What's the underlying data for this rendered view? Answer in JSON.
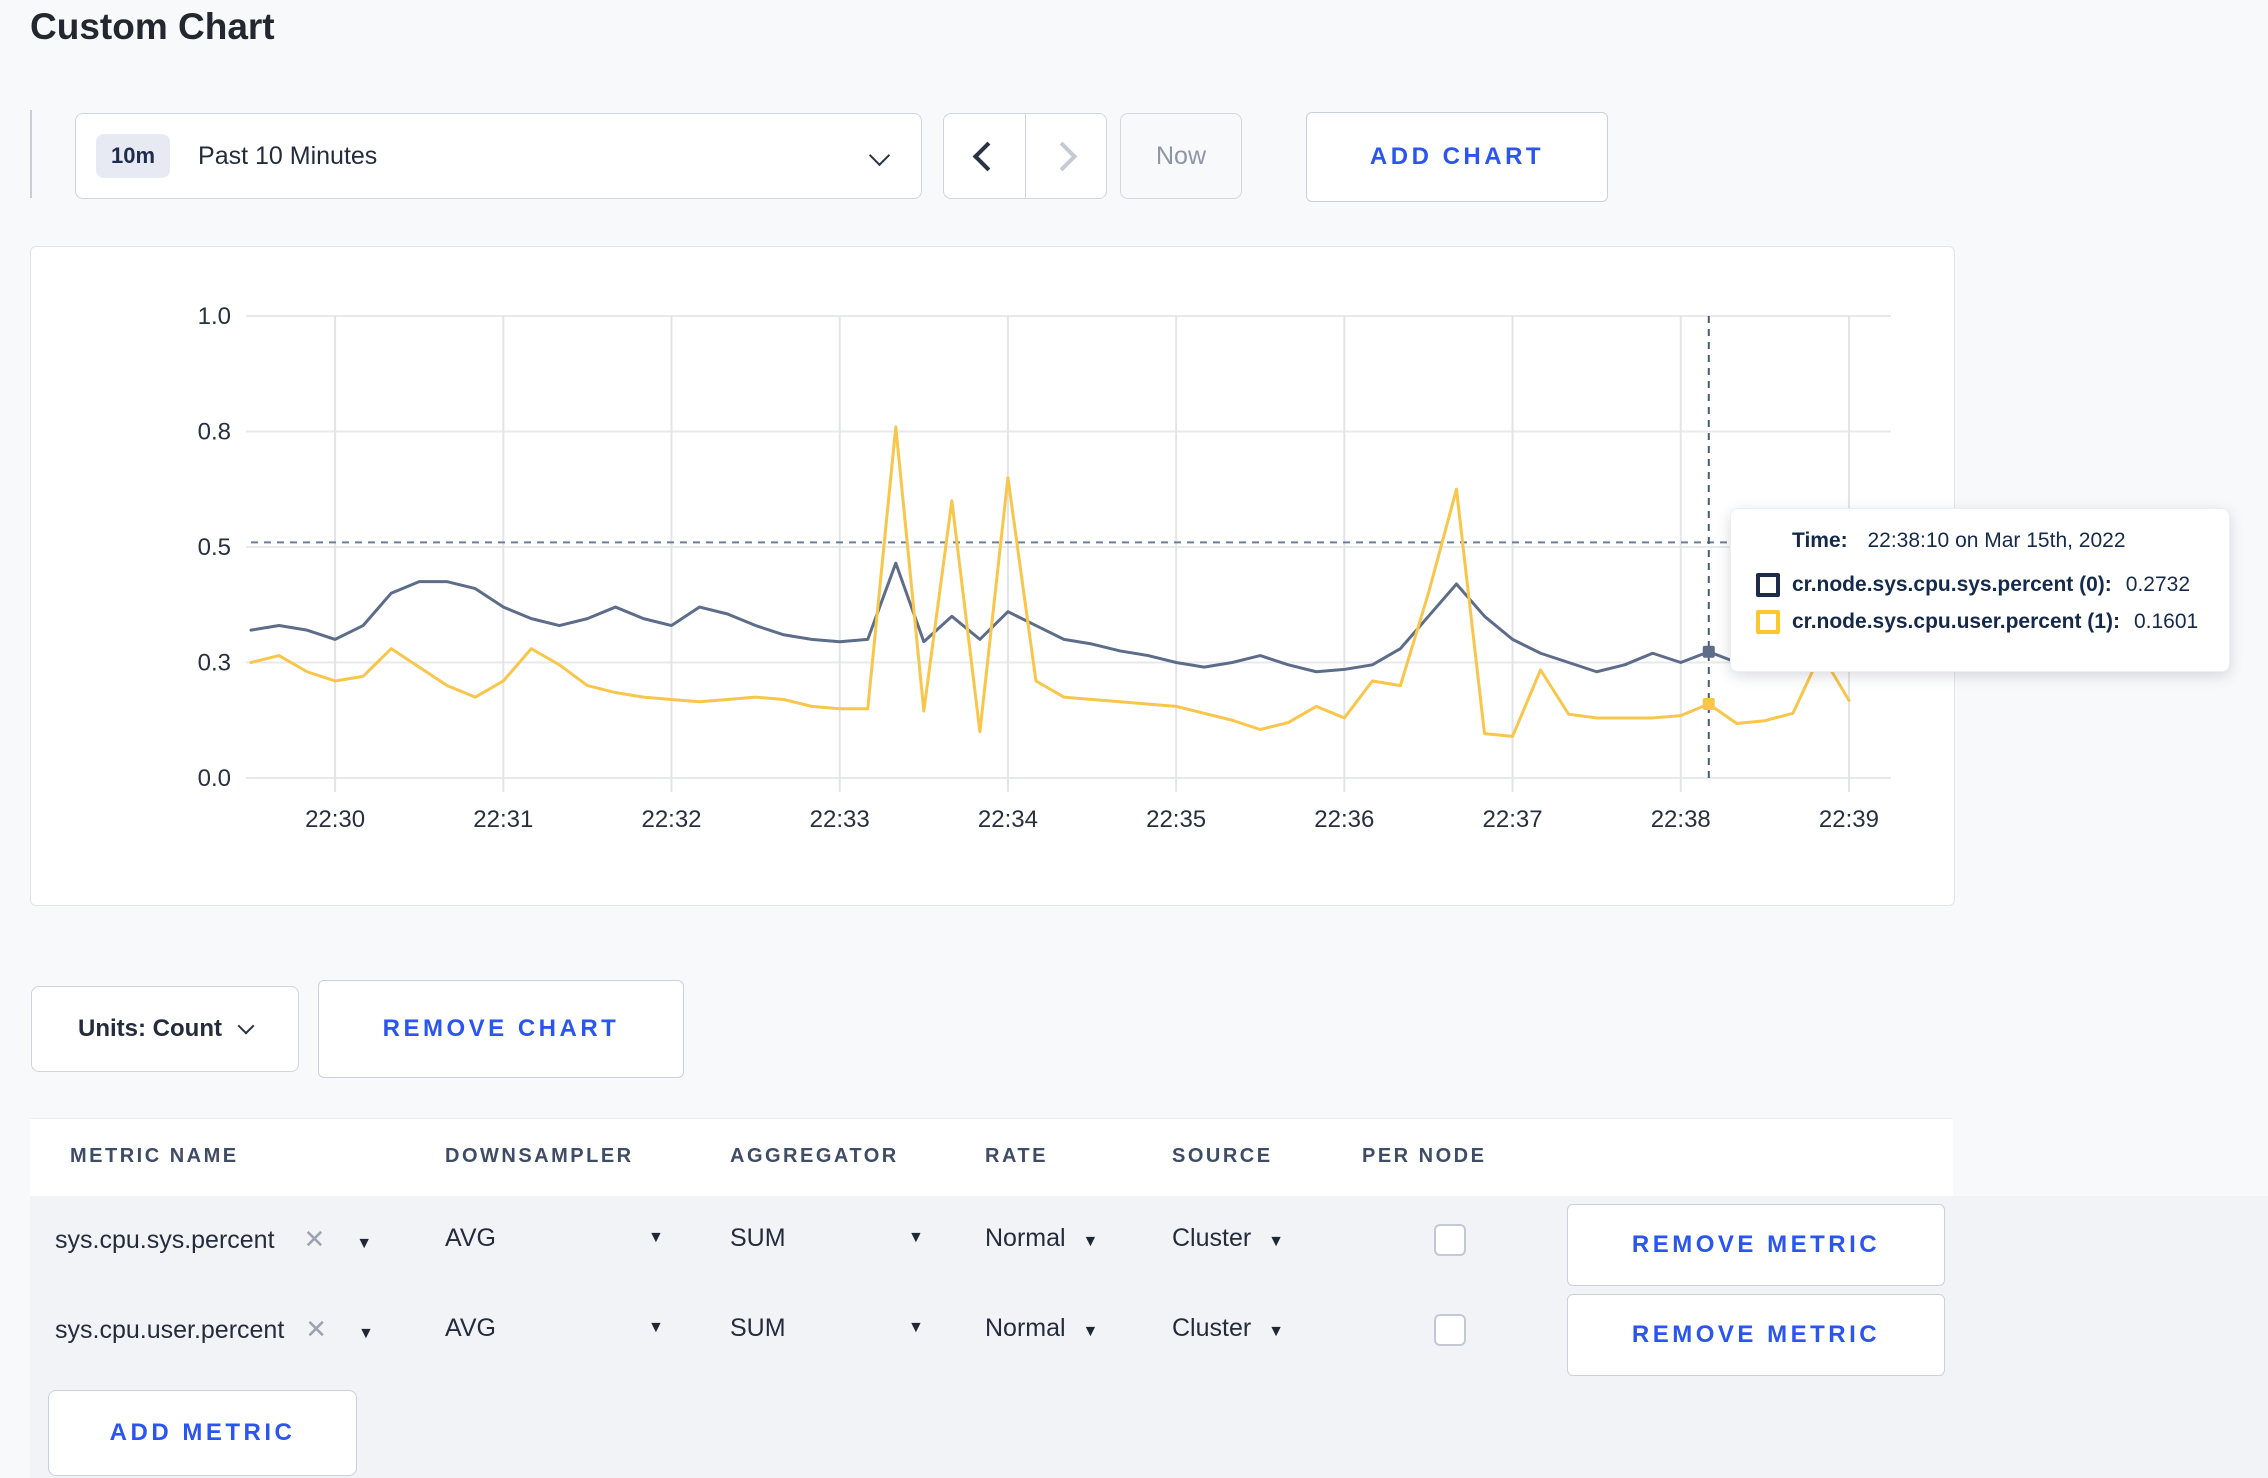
{
  "page": {
    "title": "Custom Chart"
  },
  "toolbar": {
    "range_badge": "10m",
    "range_label": "Past 10 Minutes",
    "prev_icon": "chevron-left",
    "next_icon": "chevron-right",
    "now_label": "Now",
    "add_chart_label": "ADD CHART"
  },
  "colors": {
    "accent_blue": "#2b55f0",
    "series_sys": "#5d6d89",
    "series_user": "#f8c64a",
    "tooltip_swatch_sys": "#1c2b4a",
    "tooltip_swatch_user": "#ffc72e",
    "crosshair": "#5b6b84"
  },
  "chart": {
    "tooltip": {
      "time_label": "Time:",
      "time_value": "22:38:10 on Mar 15th, 2022",
      "series": [
        {
          "label": "cr.node.sys.cpu.sys.percent (0):",
          "value": "0.2732",
          "color": "#1c2b4a"
        },
        {
          "label": "cr.node.sys.cpu.user.percent (1):",
          "value": "0.1601",
          "color": "#ffc72e"
        }
      ]
    }
  },
  "chart_data": {
    "type": "line",
    "title": "",
    "x_start": "22:29:30",
    "x_interval_sec": 10,
    "x_domain": [
      "22:29:30",
      "22:39:15"
    ],
    "x_axis": {
      "tick_labels": [
        "22:30",
        "22:31",
        "22:32",
        "22:33",
        "22:34",
        "22:35",
        "22:36",
        "22:37",
        "22:38",
        "22:39"
      ]
    },
    "y_axis": {
      "ticks": [
        0,
        0.25,
        0.5,
        0.75,
        1.0
      ],
      "tick_labels": [
        "0.0",
        "0.3",
        "0.5",
        "0.8",
        "1.0"
      ],
      "range": [
        0,
        1
      ]
    },
    "grid": true,
    "legend": "none (values shown in hover tooltip)",
    "series": [
      {
        "name": "cr.node.sys.cpu.sys.percent",
        "color": "#5d6d89",
        "values": [
          0.32,
          0.33,
          0.32,
          0.3,
          0.33,
          0.4,
          0.425,
          0.425,
          0.41,
          0.37,
          0.345,
          0.33,
          0.345,
          0.37,
          0.345,
          0.33,
          0.37,
          0.355,
          0.33,
          0.31,
          0.3,
          0.295,
          0.3,
          0.465,
          0.295,
          0.35,
          0.3,
          0.36,
          0.33,
          0.3,
          0.29,
          0.275,
          0.265,
          0.25,
          0.24,
          0.25,
          0.265,
          0.245,
          0.23,
          0.235,
          0.245,
          0.28,
          0.35,
          0.42,
          0.35,
          0.3,
          0.27,
          0.25,
          0.23,
          0.245,
          0.27,
          0.25,
          0.2732,
          0.25,
          0.26,
          0.25,
          0.26,
          0.26
        ]
      },
      {
        "name": "cr.node.sys.cpu.user.percent",
        "color": "#f8c64a",
        "values": [
          0.25,
          0.265,
          0.23,
          0.21,
          0.22,
          0.28,
          0.24,
          0.2,
          0.175,
          0.21,
          0.28,
          0.245,
          0.2,
          0.185,
          0.175,
          0.17,
          0.165,
          0.17,
          0.175,
          0.17,
          0.155,
          0.15,
          0.15,
          0.76,
          0.145,
          0.6,
          0.1,
          0.65,
          0.21,
          0.175,
          0.17,
          0.165,
          0.16,
          0.155,
          0.14,
          0.125,
          0.105,
          0.12,
          0.155,
          0.13,
          0.21,
          0.2,
          0.4,
          0.625,
          0.096,
          0.09,
          0.234,
          0.138,
          0.13,
          0.13,
          0.13,
          0.135,
          0.1601,
          0.118,
          0.124,
          0.14,
          0.27,
          0.168
        ]
      }
    ],
    "hover": {
      "time": "22:38:10",
      "crosshair_value": 0.51,
      "marker_values": [
        0.2732,
        0.1601
      ]
    }
  },
  "units_bar": {
    "units_label": "Units: Count",
    "remove_chart_label": "REMOVE CHART"
  },
  "metrics_table": {
    "headers": [
      "METRIC NAME",
      "DOWNSAMPLER",
      "AGGREGATOR",
      "RATE",
      "SOURCE",
      "PER NODE"
    ],
    "rows": [
      {
        "metric": "sys.cpu.sys.percent",
        "downsampler": "AVG",
        "aggregator": "SUM",
        "rate": "Normal",
        "source": "Cluster",
        "per_node_checked": false,
        "remove_label": "REMOVE METRIC"
      },
      {
        "metric": "sys.cpu.user.percent",
        "downsampler": "AVG",
        "aggregator": "SUM",
        "rate": "Normal",
        "source": "Cluster",
        "per_node_checked": false,
        "remove_label": "REMOVE METRIC"
      }
    ],
    "add_metric_label": "ADD METRIC"
  }
}
